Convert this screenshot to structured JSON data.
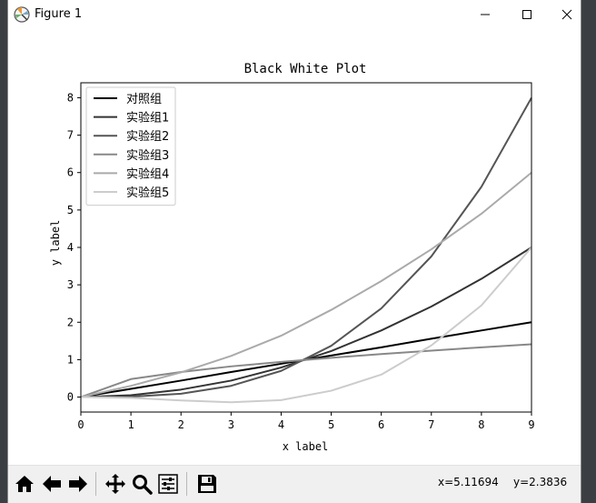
{
  "window": {
    "title": "Figure 1",
    "icon": "matplotlib-icon",
    "minimize_icon": "minimize-icon",
    "maximize_icon": "maximize-icon",
    "close_icon": "close-icon"
  },
  "toolbar": {
    "buttons": [
      "home-icon",
      "back-arrow-icon",
      "forward-arrow-icon",
      "pan-move-icon",
      "zoom-magnifier-icon",
      "configure-subplots-icon",
      "save-floppy-icon"
    ],
    "coord_x": "x=5.11694",
    "coord_y": "y=2.3836"
  },
  "chart_data": {
    "type": "line",
    "title": "Black White Plot",
    "xlabel": "x label",
    "ylabel": "y label",
    "xlim": [
      0,
      9
    ],
    "ylim": [
      -0.4,
      8.4
    ],
    "xticks": [
      "0",
      "1",
      "2",
      "3",
      "4",
      "5",
      "6",
      "7",
      "8",
      "9"
    ],
    "yticks": [
      "0",
      "1",
      "2",
      "3",
      "4",
      "5",
      "6",
      "7",
      "8"
    ],
    "grid": false,
    "legend_position": "upper-left",
    "x": [
      0,
      1,
      2,
      3,
      4,
      5,
      6,
      7,
      8,
      9
    ],
    "series": [
      {
        "name": "对照组",
        "color": "#000000",
        "values": [
          0,
          0.22,
          0.44,
          0.67,
          0.89,
          1.11,
          1.33,
          1.56,
          1.78,
          2.0
        ]
      },
      {
        "name": "实验组1",
        "color": "#333333",
        "values": [
          0,
          0.05,
          0.2,
          0.44,
          0.79,
          1.23,
          1.78,
          2.42,
          3.16,
          4.0
        ]
      },
      {
        "name": "实验组2",
        "color": "#555555",
        "values": [
          0,
          0.01,
          0.09,
          0.3,
          0.7,
          1.37,
          2.37,
          3.76,
          5.62,
          8.0
        ]
      },
      {
        "name": "实验组3",
        "color": "#888888",
        "values": [
          0,
          0.48,
          0.67,
          0.82,
          0.94,
          1.05,
          1.15,
          1.24,
          1.33,
          1.41
        ]
      },
      {
        "name": "实验组4",
        "color": "#aaaaaa",
        "values": [
          0,
          0.3,
          0.66,
          1.1,
          1.64,
          2.33,
          3.1,
          3.95,
          4.9,
          6.0
        ]
      },
      {
        "name": "实验组5",
        "color": "#cccccc",
        "values": [
          0,
          -0.02,
          -0.09,
          -0.14,
          -0.08,
          0.17,
          0.6,
          1.38,
          2.45,
          4.0
        ]
      }
    ]
  }
}
